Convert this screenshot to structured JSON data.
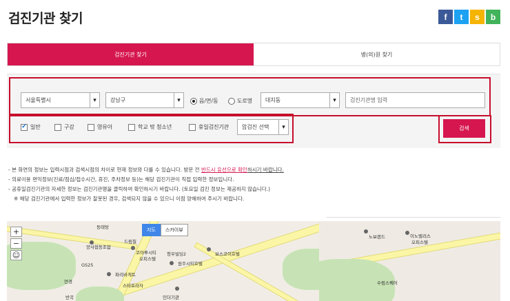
{
  "page": {
    "title": "검진기관 찾기"
  },
  "share": {
    "facebook": "f",
    "twitter": "t",
    "kakaostory": "s",
    "band": "b"
  },
  "tabs": [
    {
      "label": "검진기관 찾기"
    },
    {
      "label": "병(의)원 찾기"
    }
  ],
  "filters": {
    "region_select": "서울특별시",
    "district_select": "강남구",
    "radio_dong": "읍/면/동",
    "radio_road": "도로명",
    "dong_select": "대치동",
    "institution_input_placeholder": "검진기관명 입력",
    "checkboxes": [
      {
        "label": "일반",
        "checked": true
      },
      {
        "label": "구강",
        "checked": false
      },
      {
        "label": "영유아",
        "checked": false
      },
      {
        "label": "학교 밖 청소년",
        "checked": false
      },
      {
        "label": "휴일검진기관",
        "checked": false
      }
    ],
    "cancer_select": "암검진 선택",
    "search_button": "검색"
  },
  "notes": {
    "line1_a": "- 본 화면의 정보는 입력시점과 검색시점의 차이로 현재 정보와 다를 수 있습니다. 방문 전 ",
    "line1_b": "반드시 유선으로 확인",
    "line1_c": "하시기 바랍니다.",
    "line2": "- 의료이용 편익정보(진료/점심/접수시간, 휴진, 주차정보 등)는 해당 검진기관이 직접 입력한 정보입니다.",
    "line3": "- 공휴일검진기관의 자세한 정보는 검진기관명을 클릭하여 확인하시기 바랍니다. (토요일 검진 정보는 제공하지 않습니다.)",
    "line4": "※ 해당 검진기관에서 입력한 정보가 잘못된 경우, 검색되지 않을 수 있으니 이점 양해하여 주시기 바랍니다."
  },
  "map": {
    "zoom_in": "+",
    "zoom_out": "−",
    "type_map": "지도",
    "type_skyview": "스카이뷰",
    "labels": [
      "동태탕",
      "드림칠",
      "양사협동조합",
      "GS25",
      "연경",
      "코아루시티",
      "오피스텔",
      "청우빌딩2",
      "원주시티호텔",
      "보스코이호텔",
      "파리바게트",
      "스타프라자",
      "반곡",
      "인더기관",
      "노보랜드",
      "이노벨리스",
      "오피스텔",
      "수림스퀘어"
    ]
  }
}
